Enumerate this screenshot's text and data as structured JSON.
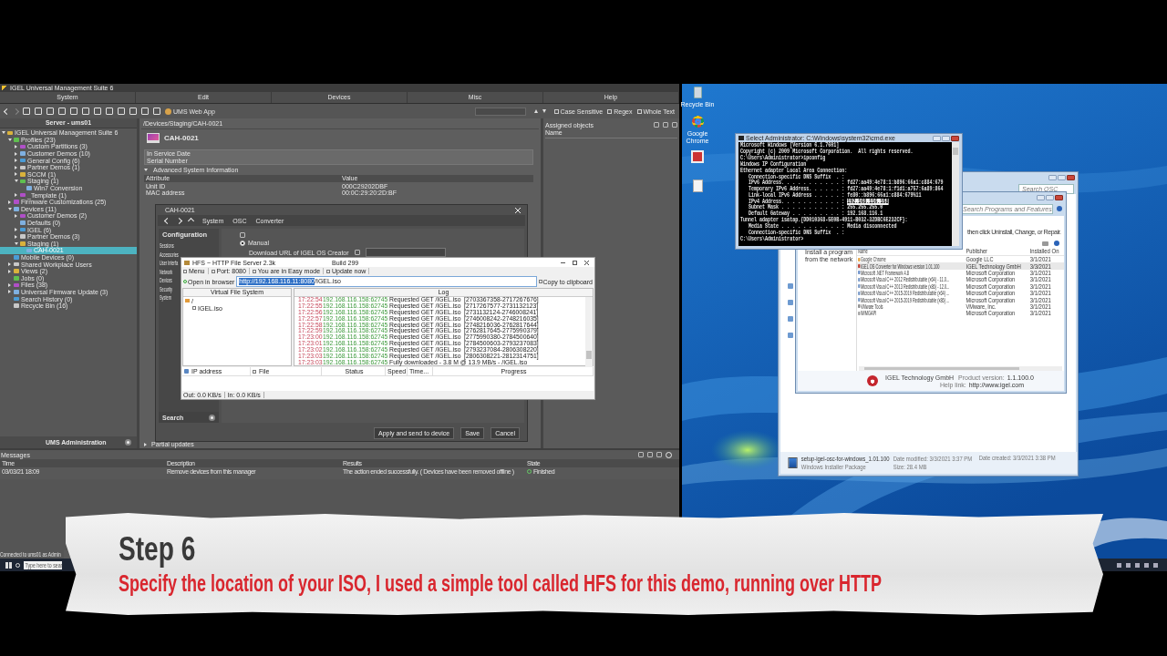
{
  "ums": {
    "title": "IGEL Universal Management Suite 6",
    "menu": [
      "System",
      "Edit",
      "Devices",
      "Misc",
      "Help"
    ],
    "web_app": "UMS Web App",
    "search_options": [
      "Case Sensitive",
      "Regex",
      "Whole Text"
    ],
    "server": "Server - ums01",
    "tree": [
      {
        "label": "IGEL Universal Management Suite 6",
        "expanded": true,
        "selected": false,
        "children": [
          {
            "label": "Profiles (23)",
            "expanded": true,
            "selected": false,
            "children": [
              {
                "label": "Custom Partitions (3)",
                "expanded": false,
                "selected": false
              },
              {
                "label": "Customer Demos (10)",
                "expanded": false,
                "selected": false
              },
              {
                "label": "General Config (6)",
                "expanded": false,
                "selected": false
              },
              {
                "label": "Partner Demos (1)",
                "expanded": false,
                "selected": false
              },
              {
                "label": "SCCM (1)",
                "expanded": false,
                "selected": false
              },
              {
                "label": "Staging (1)",
                "expanded": true,
                "selected": false,
                "children": [
                  {
                    "label": "Win7 Conversion",
                    "selected": false
                  }
                ]
              },
              {
                "label": "_Template (1)",
                "expanded": false,
                "selected": false
              }
            ]
          },
          {
            "label": "Firmware Customizations (25)",
            "expanded": false,
            "selected": false
          },
          {
            "label": "Devices (11)",
            "expanded": true,
            "selected": false,
            "children": [
              {
                "label": "Customer Demos (2)",
                "expanded": false,
                "selected": false
              },
              {
                "label": "Defaults (0)",
                "selected": false
              },
              {
                "label": "IGEL (6)",
                "expanded": false,
                "selected": false
              },
              {
                "label": "Partner Demos (3)",
                "expanded": false,
                "selected": false
              },
              {
                "label": "Staging (1)",
                "expanded": true,
                "selected": false,
                "children": [
                  {
                    "label": "CAH-0021",
                    "selected": true
                  }
                ]
              }
            ]
          },
          {
            "label": "Mobile Devices (0)",
            "selected": false
          },
          {
            "label": "Shared Workplace Users",
            "expanded": false,
            "selected": false
          },
          {
            "label": "Views (2)",
            "expanded": false,
            "selected": false
          },
          {
            "label": "Jobs (0)",
            "selected": false
          },
          {
            "label": "Files (38)",
            "expanded": false,
            "selected": false
          },
          {
            "label": "Universal Firmware Update (3)",
            "expanded": false,
            "selected": false
          },
          {
            "label": "Search History (0)",
            "selected": false
          },
          {
            "label": "Recycle Bin (16)",
            "selected": false
          }
        ]
      }
    ],
    "sidebar_footer": "UMS Administration",
    "breadcrumb": "/Devices/Staging/CAH-0021",
    "device": "CAH-0021",
    "info_rows": [
      "In Service Date",
      "Serial Number"
    ],
    "section": "Advanced System Information",
    "attr_columns": [
      "Attribute",
      "Value"
    ],
    "attr_rows": [
      {
        "attribute": "Unit ID",
        "value": "000C29202DBF"
      },
      {
        "attribute": "MAC address",
        "value": "00:0C:29:20:2D:BF"
      }
    ],
    "partial_updates": "Partial updates",
    "assigned": {
      "title": "Assigned objects",
      "column": "Name"
    },
    "messages": {
      "title": "Messages",
      "columns": [
        "Time",
        "Description",
        "Results",
        "State"
      ],
      "rows": [
        {
          "time": "03/03/21 18:09",
          "description": "Remove devices from this manager",
          "result": "The action ended successfully. ( Devices have been removed offline )",
          "state": "Finished"
        }
      ]
    },
    "status": "Connected to ums01 as Admin"
  },
  "config": {
    "title": "CAH-0021",
    "path": [
      "System",
      "OSC",
      "Converter"
    ],
    "heading": "Configuration",
    "nav": [
      "Sessions",
      "Accessories",
      "User Interfa",
      "Network",
      "Devices",
      "Security",
      "System"
    ],
    "option": {
      "label": "Manual",
      "selected": true
    },
    "url_label": "Download URL of IGEL OS Creator",
    "search": "Search",
    "buttons": [
      "Apply and send to device",
      "Save",
      "Cancel"
    ]
  },
  "hfs": {
    "title": "HFS ~ HTTP File Server 2.3k",
    "build": "Build 299",
    "toolbar": [
      "Menu",
      "Port: 8080",
      "You are in Easy mode",
      "Update now"
    ],
    "open_button": "Open in browser",
    "url": {
      "highlighted_part": "http://192.168.116.11:8080",
      "rest": "/IGEL.iso"
    },
    "copy_button": "Copy to clipboard",
    "vfs": {
      "title": "Virtual File System",
      "root": "/",
      "files": [
        "IGEL.iso"
      ]
    },
    "log": {
      "title": "Log",
      "entries": [
        {
          "time": "17:22:54",
          "address": "192.168.116.158:62745",
          "message": "Requested GET /IGEL.iso",
          "range": "[2703367358-2717267676]"
        },
        {
          "time": "17:22:55",
          "address": "192.168.116.158:62745",
          "message": "Requested GET /IGEL.iso",
          "range": "[2717267577-2731132123]"
        },
        {
          "time": "17:22:56",
          "address": "192.168.116.158:62745",
          "message": "Requested GET /IGEL.iso",
          "range": "[2731132124-2746008241]"
        },
        {
          "time": "17:22:57",
          "address": "192.168.116.158:62745",
          "message": "Requested GET /IGEL.iso",
          "range": "[2746008242-2748216035]"
        },
        {
          "time": "17:22:58",
          "address": "192.168.116.158:62745",
          "message": "Requested GET /IGEL.iso",
          "range": "[2748216036-2762817644]"
        },
        {
          "time": "17:22:59",
          "address": "192.168.116.158:62745",
          "message": "Requested GET /IGEL.iso",
          "range": "[2762817645-2775990379]"
        },
        {
          "time": "17:23:00",
          "address": "192.168.116.158:62745",
          "message": "Requested GET /IGEL.iso",
          "range": "[2775990380-2784500640]"
        },
        {
          "time": "17:23:01",
          "address": "192.168.116.158:62745",
          "message": "Requested GET /IGEL.iso",
          "range": "[2784500603-2793237083]"
        },
        {
          "time": "17:23:02",
          "address": "192.168.116.158:62745",
          "message": "Requested GET /IGEL.iso",
          "range": "[2793237084-2806308220]"
        },
        {
          "time": "17:23:03",
          "address": "192.168.116.158:62745",
          "message": "Requested GET /IGEL.iso",
          "range": "[2806308221-2812314751]"
        },
        {
          "time": "17:23:03",
          "address": "192.168.116.158:62745",
          "message": "Fully downloaded - 3.8 M @ 13.9 MB/s - /IGEL.iso"
        }
      ]
    },
    "columns": [
      "IP address",
      "File",
      "Status",
      "Speed",
      "Time...",
      "Progress"
    ],
    "status": [
      "Out: 0.0 KB/s",
      "In: 0.0 KB/s"
    ]
  },
  "cmd": {
    "title": "Select Administrator: C:\\Windows\\system32\\cmd.exe",
    "blocks": [
      [
        {
          "text": "Microsoft Windows [Version 6.1.7601]"
        },
        {
          "text": "Copyright (c) 2009 Microsoft Corporation.  All rights reserved."
        }
      ],
      [
        {
          "text": "C:\\Users\\Administrator>ipconfig"
        }
      ],
      [
        {
          "text": "Windows IP Configuration"
        }
      ],
      [
        {
          "text": "Ethernet adapter Local Area Connection:"
        }
      ],
      [
        {
          "text": "   Connection-specific DNS Suffix  . :"
        },
        {
          "text": "   IPv6 Address. . . . . . . . . . . : fd27:aa49:4e78:1:b896:66a1:c884:679"
        },
        {
          "text": "   Temporary IPv6 Address. . . . . . : fd27:aa49:4e78:1:f1d1:a757:6a89:864"
        },
        {
          "text": "   Link-local IPv6 Address . . . . . : fe80::b896:66a1:c884:679%11"
        },
        {
          "text": "   IPv4 Address. . . . . . . . . . . : ",
          "highlight": "192.168.116.158"
        },
        {
          "text": "   Subnet Mask . . . . . . . . . . . : 255.255.255.0"
        },
        {
          "text": "   Default Gateway . . . . . . . . . : 192.168.116.1"
        }
      ],
      [
        {
          "text": "Tunnel adapter isatap.{DD010368-5E0B-4911-B032-32DBC6E232CF}:"
        }
      ],
      [
        {
          "text": "   Media State . . . . . . . . . . . : Media disconnected"
        },
        {
          "text": "   Connection-specific DNS Suffix  . :"
        }
      ],
      [
        {
          "text": "C:\\Users\\Administrator>"
        }
      ]
    ]
  },
  "explorer": {
    "search": "Search OSC",
    "file": {
      "name": "setup-igel-osc-for-windows_1.01.100",
      "modified": "Date modified: 3/3/2021 3:37 PM",
      "created": "Date created: 3/3/2021 3:38 PM",
      "type": "Windows Installer Package",
      "size": "Size: 28.4 MB"
    }
  },
  "programs": {
    "search": "Search Programs and Features",
    "hint": "then click Uninstall, Change, or Repair.",
    "side_link": "Install a program from the network",
    "columns": [
      "Name",
      "Publisher",
      "Installed On"
    ],
    "rows": [
      {
        "name": "Google Chrome",
        "publisher": "Google LLC",
        "installed": "3/1/2021",
        "selected": false
      },
      {
        "name": "IGEL OS Converter for Windows version 1.01.100",
        "publisher": "IGEL Technology GmbH",
        "installed": "3/3/2021",
        "selected": true
      },
      {
        "name": "Microsoft .NET Framework 4.8",
        "publisher": "Microsoft Corporation",
        "installed": "3/1/2021",
        "selected": false
      },
      {
        "name": "Microsoft Visual C++ 2012 Redistributable (x64) - 11.0...",
        "publisher": "Microsoft Corporation",
        "installed": "3/1/2021",
        "selected": false
      },
      {
        "name": "Microsoft Visual C++ 2013 Redistributable (x86) - 12.0...",
        "publisher": "Microsoft Corporation",
        "installed": "3/1/2021",
        "selected": false
      },
      {
        "name": "Microsoft Visual C++ 2015-2019 Redistributable (x64) ...",
        "publisher": "Microsoft Corporation",
        "installed": "3/1/2021",
        "selected": false
      },
      {
        "name": "Microsoft Visual C++ 2015-2019 Redistributable (x86) ...",
        "publisher": "Microsoft Corporation",
        "installed": "3/1/2021",
        "selected": false
      },
      {
        "name": "VMware Tools",
        "publisher": "VMware, Inc.",
        "installed": "3/1/2021",
        "selected": false
      },
      {
        "name": "WIMGAPI",
        "publisher": "Microsoft Corporation",
        "installed": "3/1/2021",
        "selected": false
      }
    ],
    "details": {
      "publisher": "IGEL Technology GmbH",
      "version_label": "Product version:",
      "version": "1.1.100.0",
      "help_label": "Help link:",
      "help": "http://www.igel.com"
    }
  },
  "desktop_icons": [
    "Recycle Bin",
    "Google Chrome"
  ],
  "taskbar": {
    "search": "Type here to sear"
  },
  "caption": {
    "step": "Step 6",
    "text": "Specify the location of your ISO, I used a simple tool called HFS for this demo, running over HTTP"
  }
}
